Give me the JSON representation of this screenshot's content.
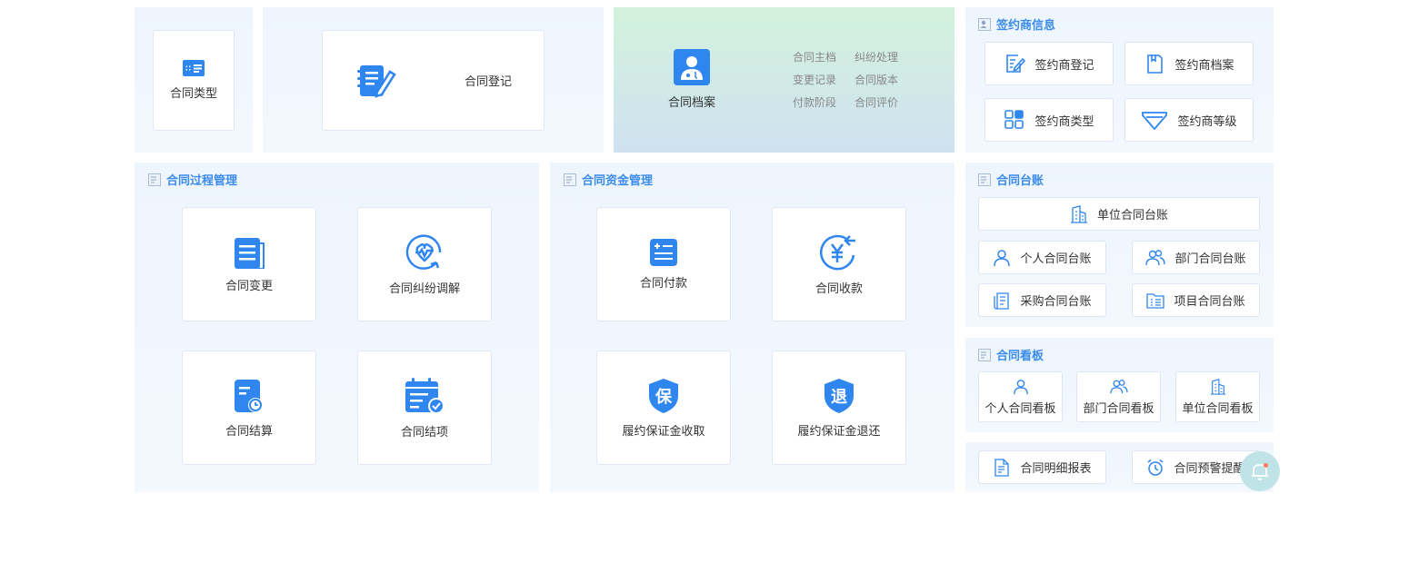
{
  "top": {
    "contract_type": "合同类型",
    "contract_register": "合同登记",
    "archive": {
      "label": "合同档案",
      "links": [
        "合同主档",
        "纠纷处理",
        "变更记录",
        "合同版本",
        "付款阶段",
        "合同评价"
      ]
    }
  },
  "signer": {
    "title": "签约商信息",
    "items": [
      "签约商登记",
      "签约商档案",
      "签约商类型",
      "签约商等级"
    ]
  },
  "process": {
    "title": "合同过程管理",
    "items": [
      "合同变更",
      "合同纠纷调解",
      "合同结算",
      "合同结项"
    ]
  },
  "funds": {
    "title": "合同资金管理",
    "items": [
      "合同付款",
      "合同收款",
      "履约保证金收取",
      "履约保证金退还"
    ]
  },
  "ledger": {
    "title": "合同台账",
    "items": [
      "单位合同台账",
      "个人合同台账",
      "部门合同台账",
      "采购合同台账",
      "项目合同台账"
    ]
  },
  "board": {
    "title": "合同看板",
    "items": [
      "个人合同看板",
      "部门合同看板",
      "单位合同看板"
    ]
  },
  "bottom": {
    "items": [
      "合同明细报表",
      "合同预警提醒"
    ]
  },
  "colors": {
    "accent": "#3b8cec",
    "icon": "#2f86ef"
  }
}
